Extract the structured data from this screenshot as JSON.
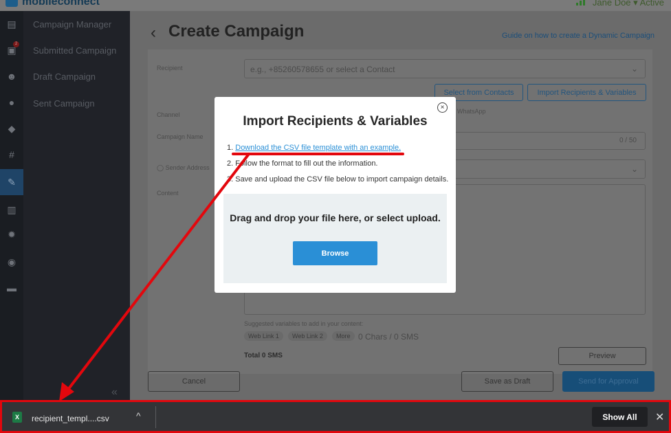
{
  "app": {
    "logo_text": "mobileconnect",
    "user": "Jane Doe",
    "status": "Active"
  },
  "rail_icons": [
    "chat-icon",
    "inbox-icon",
    "people-icon",
    "location-icon",
    "tag-icon",
    "hashtag-icon",
    "campaign-icon",
    "analytics-icon",
    "gear-icon",
    "account-icon",
    "cart-icon"
  ],
  "rail_badge": "2",
  "sidebar": {
    "items": [
      {
        "label": "Campaign Manager"
      },
      {
        "label": "Submitted Campaign"
      },
      {
        "label": "Draft Campaign"
      },
      {
        "label": "Sent Campaign"
      }
    ],
    "collapse": "«"
  },
  "page": {
    "back": "‹",
    "title": "Create Campaign",
    "guide_link": "Guide on how to create a Dynamic Campaign"
  },
  "form": {
    "recipient_label": "Recipient",
    "recipient_placeholder": "e.g., +85260578655 or select a Contact",
    "select_contacts": "Select from Contacts",
    "import_recipients": "Import Recipients & Variables",
    "channel_label": "Channel",
    "channel_option": "WhatsApp",
    "campaign_name_label": "Campaign Name",
    "campaign_name_counter": "0 / 50",
    "sender_label": "Sender Address",
    "content_label": "Content",
    "suggested_vars": "Suggested variables to add in your content:",
    "chips": [
      "Web Link 1",
      "Web Link 2",
      "More"
    ],
    "char_count": "0 Chars / 0 SMS",
    "total": "Total 0 SMS",
    "preview": "Preview"
  },
  "footer": {
    "cancel": "Cancel",
    "save_draft": "Save as Draft",
    "send": "Send for Approval"
  },
  "modal": {
    "title": "Import Recipients & Variables",
    "close": "×",
    "step1_num": "1.",
    "step1_link": "Download the CSV file template with an example.",
    "step2": "2. Follow the format to fill out the information.",
    "step3": "3. Save and upload the CSV file below to import campaign details.",
    "dropzone_text": "Drag and drop your file here, or select upload.",
    "browse": "Browse"
  },
  "download_bar": {
    "file_icon_letter": "X",
    "file_name": "recipient_templ....csv",
    "chevron": "^",
    "show_all": "Show All",
    "close": "✕"
  },
  "colors": {
    "annotation": "#e3070d",
    "primary": "#2a8fd6",
    "excel": "#1d7a45"
  }
}
